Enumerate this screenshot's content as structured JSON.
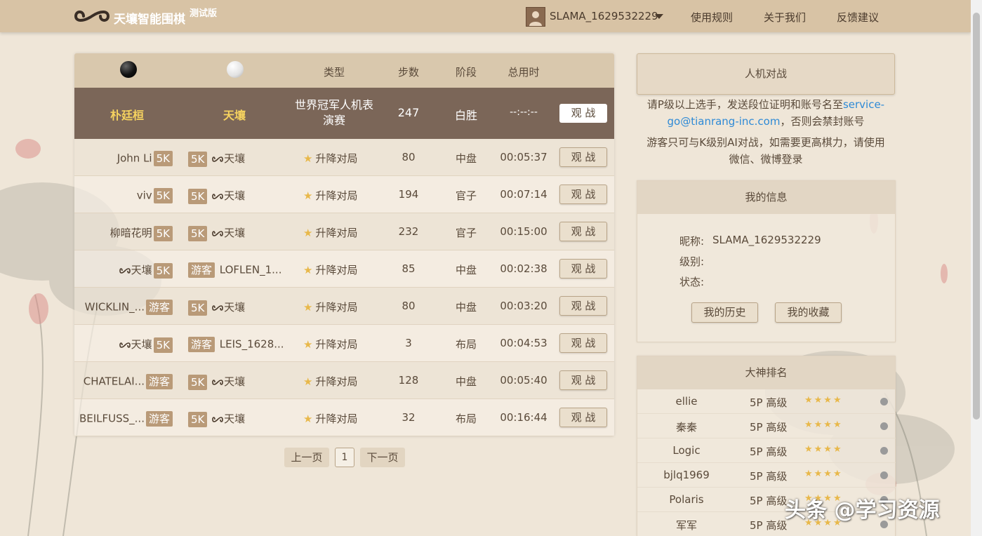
{
  "header": {
    "brand": "天壤智能围棋",
    "beta": "测试版",
    "username": "SLAMA_1629532229",
    "nav": [
      "使用规则",
      "关于我们",
      "反馈建议"
    ]
  },
  "table": {
    "headers": {
      "type": "类型",
      "moves": "步数",
      "stage": "阶段",
      "time": "总用时"
    },
    "featured": {
      "black": "朴廷桓",
      "white": "天壤",
      "type_line1": "世界冠军人机表",
      "type_line2": "演赛",
      "moves": "247",
      "stage": "白胜",
      "time": "--:--:--",
      "watch": "观 战"
    },
    "rows": [
      {
        "black": "John Li",
        "black_rank": "5K",
        "white_rank": "5K",
        "white": "天壤",
        "white_logo": true,
        "black_logo": false,
        "type": "升降对局",
        "moves": "80",
        "stage": "中盘",
        "time": "00:05:37",
        "watch": "观 战"
      },
      {
        "black": "viv",
        "black_rank": "5K",
        "white_rank": "5K",
        "white": "天壤",
        "white_logo": true,
        "black_logo": false,
        "type": "升降对局",
        "moves": "194",
        "stage": "官子",
        "time": "00:07:14",
        "watch": "观 战"
      },
      {
        "black": "柳暗花明",
        "black_rank": "5K",
        "white_rank": "5K",
        "white": "天壤",
        "white_logo": true,
        "black_logo": false,
        "type": "升降对局",
        "moves": "232",
        "stage": "官子",
        "time": "00:15:00",
        "watch": "观 战"
      },
      {
        "black": "天壤",
        "black_rank": "5K",
        "white_rank": "游客",
        "white": "LOFLEN_1...",
        "white_logo": false,
        "black_logo": true,
        "type": "升降对局",
        "moves": "85",
        "stage": "中盘",
        "time": "00:02:38",
        "watch": "观 战"
      },
      {
        "black": "WICKLIN_...",
        "black_rank": "游客",
        "white_rank": "5K",
        "white": "天壤",
        "white_logo": true,
        "black_logo": false,
        "type": "升降对局",
        "moves": "80",
        "stage": "中盘",
        "time": "00:03:20",
        "watch": "观 战"
      },
      {
        "black": "天壤",
        "black_rank": "5K",
        "white_rank": "游客",
        "white": "LEIS_1628...",
        "white_logo": false,
        "black_logo": true,
        "type": "升降对局",
        "moves": "3",
        "stage": "布局",
        "time": "00:04:53",
        "watch": "观 战"
      },
      {
        "black": "CHATELAI...",
        "black_rank": "游客",
        "white_rank": "5K",
        "white": "天壤",
        "white_logo": true,
        "black_logo": false,
        "type": "升降对局",
        "moves": "128",
        "stage": "中盘",
        "time": "00:05:40",
        "watch": "观 战"
      },
      {
        "black": "BEILFUSS_...",
        "black_rank": "游客",
        "white_rank": "5K",
        "white": "天壤",
        "white_logo": true,
        "black_logo": false,
        "type": "升降对局",
        "moves": "32",
        "stage": "布局",
        "time": "00:16:44",
        "watch": "观 战"
      }
    ]
  },
  "pagination": {
    "prev": "上一页",
    "current": "1",
    "next": "下一页"
  },
  "ai_match": {
    "button": "人机对战",
    "notice1_a": "请P级以上选手，发送段位证明和账号名至",
    "notice1_link1": "service-",
    "notice1_link2": "go@tianrang-inc.com",
    "notice1_b": "，否则会禁封账号",
    "notice2_line1": "游客只可与K级别AI对战，如需要更高棋力，请使用",
    "notice2_line2": "微信、微博登录"
  },
  "my_info": {
    "title": "我的信息",
    "nickname_label": "昵称:",
    "nickname": "SLAMA_1629532229",
    "level_label": "级别:",
    "status_label": "状态:",
    "history": "我的历史",
    "favorites": "我的收藏"
  },
  "ranking": {
    "title": "大神排名",
    "rows": [
      {
        "name": "ellie",
        "level": "5P 高级",
        "stars": "★★★★"
      },
      {
        "name": "秦秦",
        "level": "5P 高级",
        "stars": "★★★★"
      },
      {
        "name": "Logic",
        "level": "5P 高级",
        "stars": "★★★★"
      },
      {
        "name": "bjlq1969",
        "level": "5P 高级",
        "stars": "★★★★"
      },
      {
        "name": "Polaris",
        "level": "5P 高级",
        "stars": "★★★★"
      },
      {
        "name": "军军",
        "level": "5P 高级",
        "stars": "★★★★"
      }
    ]
  },
  "watermark": "头条 @学习资源",
  "colors": {
    "header_bg": "#d8c3a5",
    "featured_bg": "#7b6658",
    "gold": "#f6d35f",
    "link": "#2e8ad6",
    "badge": "#b99a78",
    "star": "#e8b84a"
  }
}
